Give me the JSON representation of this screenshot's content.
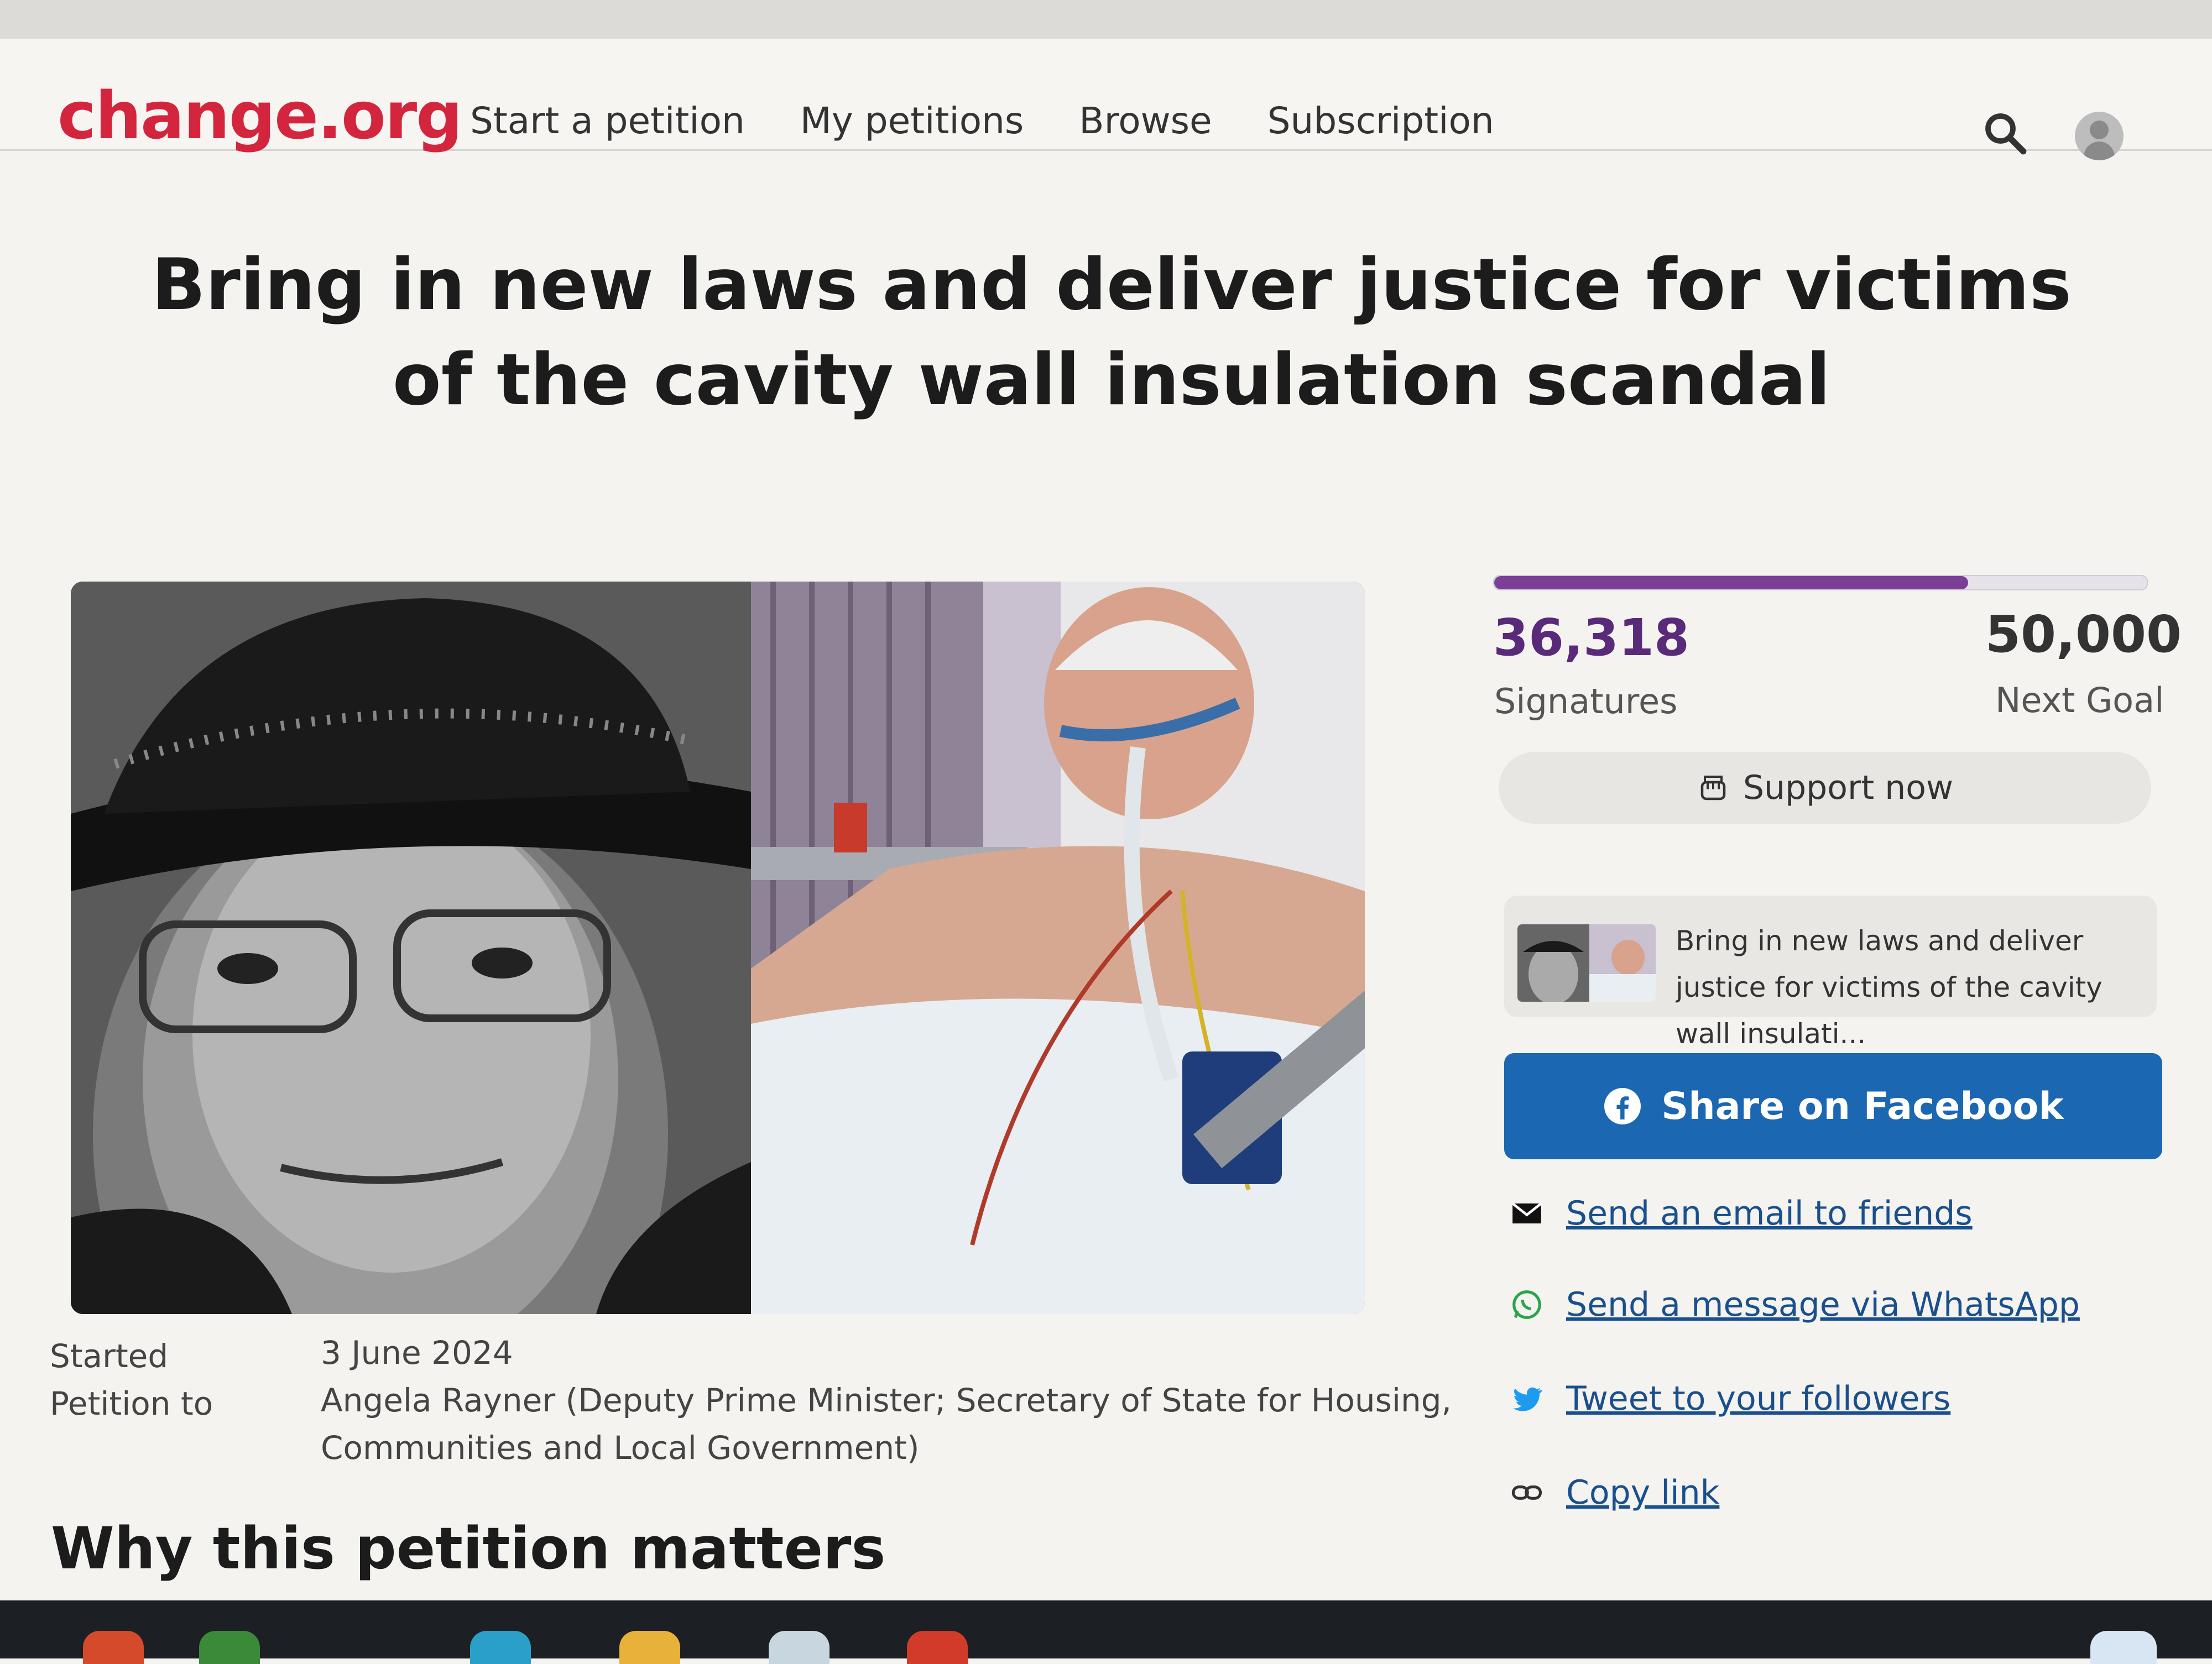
{
  "header": {
    "logo": "change.org",
    "nav": [
      "Start a petition",
      "My petitions",
      "Browse",
      "Subscription"
    ],
    "search_icon": "search-icon",
    "avatar_icon": "user-avatar-icon"
  },
  "petition": {
    "title": "Bring in new laws and deliver justice for victims of the cavity wall insulation scandal",
    "started_label": "Started",
    "started_value": "3 June 2024",
    "petition_to_label": "Petition to",
    "petition_to_value": "Angela Rayner (Deputy Prime Minister; Secretary of State for Housing, Communities and Local Government)",
    "why_heading": "Why this petition matters"
  },
  "signatures": {
    "count": "36,318",
    "count_label": "Signatures",
    "goal": "50,000",
    "goal_label": "Next Goal",
    "progress_fraction": 0.726
  },
  "actions": {
    "support": "Support now",
    "card_text": "Bring in new laws and deliver justice for victims of the cavity wall insulati...",
    "facebook": "Share on Facebook",
    "email": "Send an email to friends",
    "whatsapp": "Send a message via WhatsApp",
    "tweet": "Tweet to your followers",
    "copy": "Copy link"
  },
  "colors": {
    "brand": "#d3263e",
    "progress": "#7b3f98",
    "facebook": "#1b67b1",
    "link": "#1a4f8d"
  }
}
